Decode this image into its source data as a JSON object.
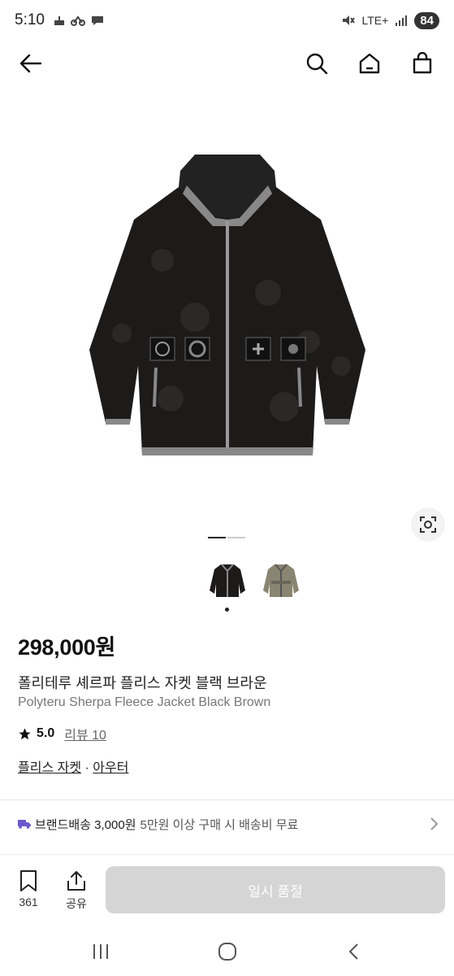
{
  "status": {
    "time": "5:10",
    "network": "LTE+",
    "battery": "84"
  },
  "product": {
    "price": "298,000원",
    "title_ko": "폴리테루 셰르파 플리스 자켓 블랙 브라운",
    "title_en": "Polyteru Sherpa Fleece Jacket Black Brown",
    "rating": "5.0",
    "reviews": "리뷰 10",
    "category_1": "플리스 자켓",
    "category_sep": " · ",
    "category_2": "아우터"
  },
  "shipping": {
    "brand_fee": "브랜드배송 3,000원",
    "condition": "5만원 이상 구매 시 배송비 무료"
  },
  "bottom": {
    "bookmark_count": "361",
    "share_label": "공유",
    "soldout_label": "일시 품절"
  },
  "colors": {
    "accent": "#6a5acd",
    "button_disabled": "#d5d5d5"
  },
  "icons": [
    "back-arrow-icon",
    "search-icon",
    "home-icon",
    "shopping-bag-icon",
    "lens-icon",
    "bookmark-icon",
    "share-icon",
    "truck-icon",
    "chevron-right-icon"
  ]
}
